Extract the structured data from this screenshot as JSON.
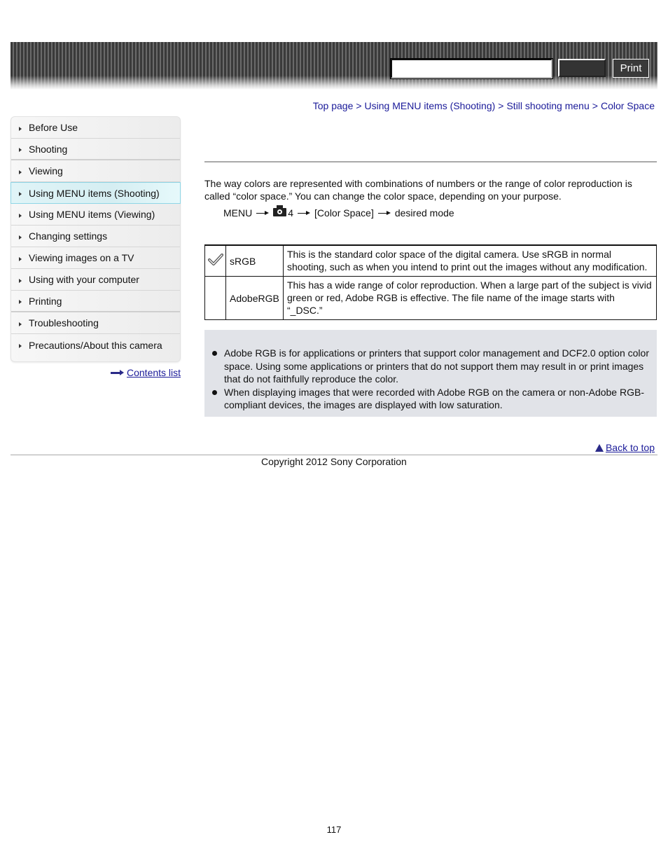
{
  "header": {
    "search_value": "",
    "search_button_label": "",
    "print_label": "Print"
  },
  "breadcrumb": [
    {
      "label": "Top page"
    },
    {
      "label": "Using MENU items (Shooting)"
    },
    {
      "label": "Still shooting menu"
    },
    {
      "label": "Color Space"
    }
  ],
  "breadcrumb_separator": ">",
  "sidebar": {
    "items": [
      {
        "label": "Before Use"
      },
      {
        "label": "Shooting"
      },
      {
        "label": "Viewing"
      },
      {
        "label": "Using MENU items (Shooting)",
        "active": true
      },
      {
        "label": "Using MENU items (Viewing)"
      },
      {
        "label": "Changing settings"
      },
      {
        "label": "Viewing images on a TV"
      },
      {
        "label": "Using with your computer"
      },
      {
        "label": "Printing"
      },
      {
        "label": "Troubleshooting"
      },
      {
        "label": "Precautions/About this camera"
      }
    ],
    "contents_list_label": "Contents list"
  },
  "main": {
    "intro": "The way colors are represented with combinations of numbers or the range of color reproduction is called “color space.” You can change the color space, depending on your purpose.",
    "menu_path": {
      "menu": "MENU",
      "camera_tab": "4",
      "item": "[Color Space]",
      "target": "desired mode"
    },
    "options": [
      {
        "default": true,
        "name": "sRGB",
        "description": "This is the standard color space of the digital camera. Use sRGB in normal shooting, such as when you intend to print out the images without any modification."
      },
      {
        "default": false,
        "name": "AdobeRGB",
        "description": "This has a wide range of color reproduction. When a large part of the subject is vivid green or red, Adobe RGB is effective. The file name of the image starts with “_DSC.”"
      }
    ],
    "notes": [
      "Adobe RGB is for applications or printers that support color management and DCF2.0 option color space. Using some applications or printers that do not support them may result in or print images that do not faithfully reproduce the color.",
      "When displaying images that were recorded with Adobe RGB on the camera or non-Adobe RGB-compliant devices, the images are displayed with low saturation."
    ]
  },
  "footer": {
    "back_to_top": "Back to top",
    "copyright": "Copyright 2012 Sony Corporation",
    "page_number": "117"
  }
}
